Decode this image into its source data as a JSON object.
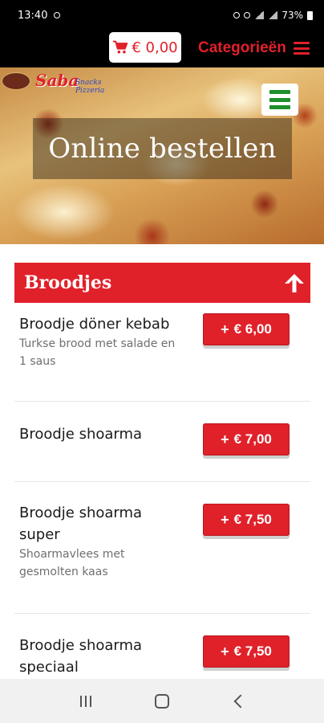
{
  "status_bar": {
    "time": "13:40",
    "battery": "73%"
  },
  "header": {
    "cart_total": "€ 0,00",
    "categories_label": "Categorieën"
  },
  "hero": {
    "logo_name": "Saba",
    "logo_tagline": "Snacks Pizzeria",
    "title": "Online bestellen"
  },
  "category": {
    "title": "Broodjes"
  },
  "products": [
    {
      "name": "Broodje döner kebab",
      "description": "Turkse brood met salade en 1 saus",
      "price": "€ 6,00"
    },
    {
      "name": "Broodje shoarma",
      "description": "",
      "price": "€ 7,00"
    },
    {
      "name": "Broodje shoarma super",
      "description": "Shoarmavlees met gesmolten kaas",
      "price": "€ 7,50"
    },
    {
      "name": "Broodje shoarma speciaal",
      "description": "",
      "price": "€ 7,50"
    }
  ],
  "colors": {
    "accent": "#e0212a",
    "menu_green": "#1f8f2b",
    "header_bg": "#000000"
  },
  "icons": {
    "cart": "cart-icon",
    "menu": "hamburger-icon",
    "collapse": "arrow-up-icon",
    "add": "plus-icon"
  }
}
